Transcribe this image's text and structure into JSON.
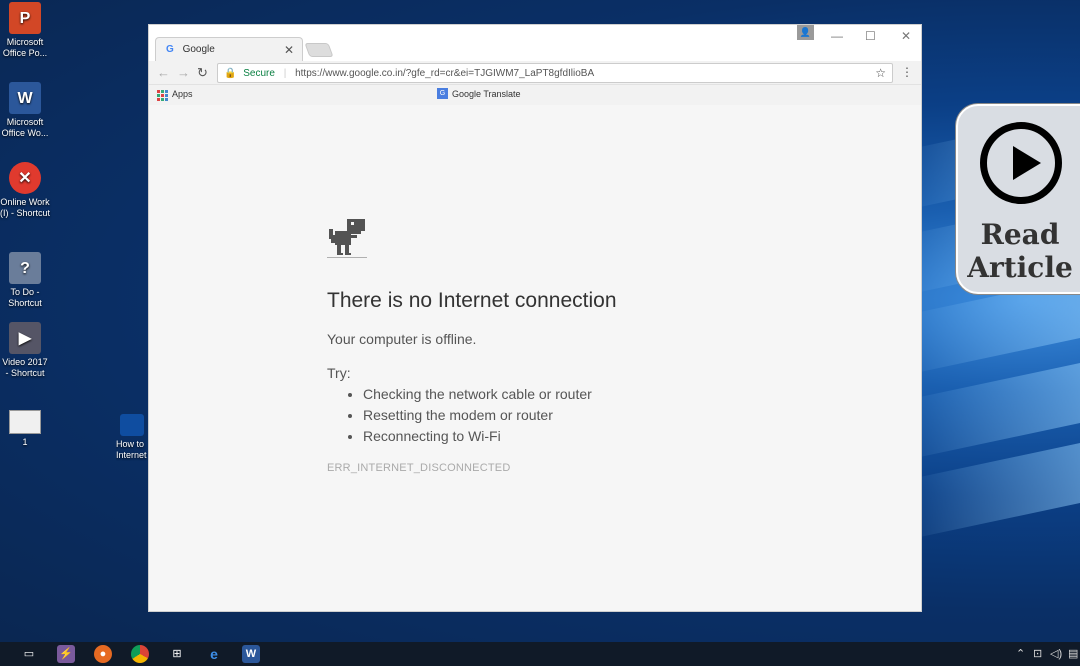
{
  "desktop": {
    "icons": [
      {
        "label": "Microsoft Office Po...",
        "glyph": "P",
        "color": "#d24726"
      },
      {
        "label": "Microsoft Office Wo...",
        "glyph": "W",
        "color": "#2b579a"
      },
      {
        "label": "Online Work (I) - Shortcut",
        "glyph": "✕",
        "color": "#e03a2e"
      },
      {
        "label": "To Do - Shortcut",
        "glyph": "?",
        "color": "#6a7d9a"
      },
      {
        "label": "Video 2017 - Shortcut",
        "glyph": "▶",
        "color": "#556"
      },
      {
        "label": "1",
        "glyph": "",
        "color": "#f0f0f0"
      }
    ],
    "partial_icon_label": "How to Internet"
  },
  "browser": {
    "tab_title": "Google",
    "tab_icon": "G",
    "address": {
      "secure_label": "Secure",
      "url": "https://www.google.co.in/?gfe_rd=cr&ei=TJGIWM7_LaPT8gfdIlioBA"
    },
    "bookmarks": {
      "apps_label": "Apps",
      "translate_label": "Google Translate"
    },
    "window_controls": {
      "minimize": "—",
      "maximize": "☐",
      "close": "✕"
    }
  },
  "error_page": {
    "title": "There is no Internet connection",
    "subtitle": "Your computer is offline.",
    "try_label": "Try:",
    "suggestions": [
      "Checking the network cable or router",
      "Resetting the modem or router",
      "Reconnecting to Wi-Fi"
    ],
    "error_code": "ERR_INTERNET_DISCONNECTED"
  },
  "overlay": {
    "read_article_line1": "Read",
    "read_article_line2": "Article"
  },
  "taskbar": {
    "icons": [
      "task-view-icon",
      "winrar-icon",
      "firefox-icon",
      "chrome-icon",
      "store-icon",
      "edge-icon",
      "word-icon"
    ]
  }
}
